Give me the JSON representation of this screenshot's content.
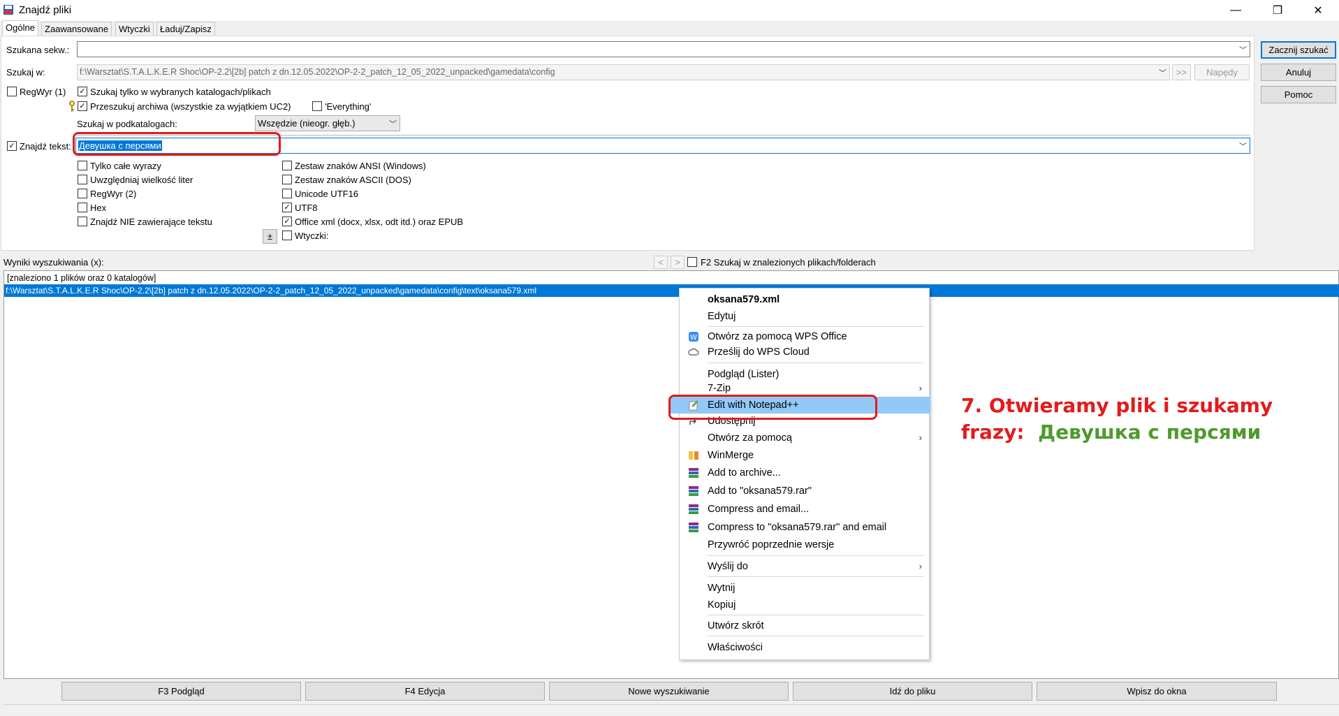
{
  "window": {
    "title": "Znajdź pliki",
    "minimize": "—",
    "maximize": "❐",
    "close": "✕"
  },
  "tabs": [
    "Ogólne",
    "Zaawansowane",
    "Wtyczki",
    "Ładuj/Zapisz"
  ],
  "form": {
    "search_for_label": "Szukana sekw.:",
    "search_for_value": "",
    "search_in_label": "Szukaj w:",
    "search_in_value": "f:\\Warsztat\\S.T.A.L.K.E.R Shoc\\OP-2.2\\[2b] patch z dn.12.05.2022\\OP-2-2_patch_12_05_2022_unpacked\\gamedata\\config",
    "more_btn": ">>",
    "drives_btn": "Napędy",
    "regex1_label": "RegWyr (1)",
    "only_selected_label": "Szukaj tylko w wybranych katalogach/plikach",
    "archives_label": "Przeszukuj archiwa (wszystkie za wyjątkiem UC2)",
    "everything_label": "'Everything'",
    "subdirs_label": "Szukaj w podkatalogach:",
    "subdirs_value": "Wszędzie (nieogr. głęb.)",
    "find_text_label": "Znajdź tekst:",
    "find_text_value": "Девушка с персями"
  },
  "options_left": [
    {
      "label": "Tylko całe wyrazy",
      "checked": false
    },
    {
      "label": "Uwzględniaj wielkość liter",
      "checked": false
    },
    {
      "label": "RegWyr (2)",
      "checked": false
    },
    {
      "label": "Hex",
      "checked": false
    },
    {
      "label": "Znajdź NIE zawierające tekstu",
      "checked": false
    }
  ],
  "options_right": [
    {
      "label": "Zestaw znaków ANSI (Windows)",
      "checked": false
    },
    {
      "label": "Zestaw znaków ASCII (DOS)",
      "checked": false
    },
    {
      "label": "Unicode UTF16",
      "checked": false
    },
    {
      "label": "UTF8",
      "checked": true
    },
    {
      "label": "Office xml (docx, xlsx, odt itd.) oraz EPUB",
      "checked": true
    },
    {
      "label": "Wtyczki:",
      "checked": false
    }
  ],
  "plus_minus": "±",
  "side_buttons": {
    "start": "Zacznij szukać",
    "cancel": "Anuluj",
    "help": "Pomoc"
  },
  "results": {
    "label": "Wyniki wyszukiwania (x):",
    "prev": "<",
    "next": ">",
    "f2_label": "F2 Szukaj w znalezionych plikach/folderach",
    "summary": "[znaleziono 1 plików oraz 0 katalogów]",
    "selected_path": "f:\\Warsztat\\S.T.A.L.K.E.R Shoc\\OP-2.2\\[2b] patch z dn.12.05.2022\\OP-2-2_patch_12_05_2022_unpacked\\gamedata\\config\\text\\oksana579.xml"
  },
  "context_menu": {
    "header": "oksana579.xml",
    "items": [
      "Edytuj",
      "Otwórz za pomocą WPS Office",
      "Prześlij do WPS Cloud",
      "Podgląd (Lister)",
      "7-Zip",
      "Edit with Notepad++",
      "Udostępnij",
      "Otwórz za pomocą",
      "WinMerge",
      "Add to archive...",
      "Add to \"oksana579.rar\"",
      "Compress and email...",
      "Compress to \"oksana579.rar\" and email",
      "Przywróć poprzednie wersje",
      "Wyślij do",
      "Wytnij",
      "Kopiuj",
      "Utwórz skrót",
      "Właściwości"
    ]
  },
  "bottom_buttons": [
    "F3 Podgląd",
    "F4 Edycja",
    "Nowe wyszukiwanie",
    "Idź do pliku",
    "Wpisz do okna"
  ],
  "annotation": {
    "line1": "7. Otwieramy plik i szukamy",
    "line2_prefix": "frazy:",
    "line2_phrase": "Девушка с персями",
    "red": "#e31b1b",
    "green": "#4f9a2e"
  }
}
